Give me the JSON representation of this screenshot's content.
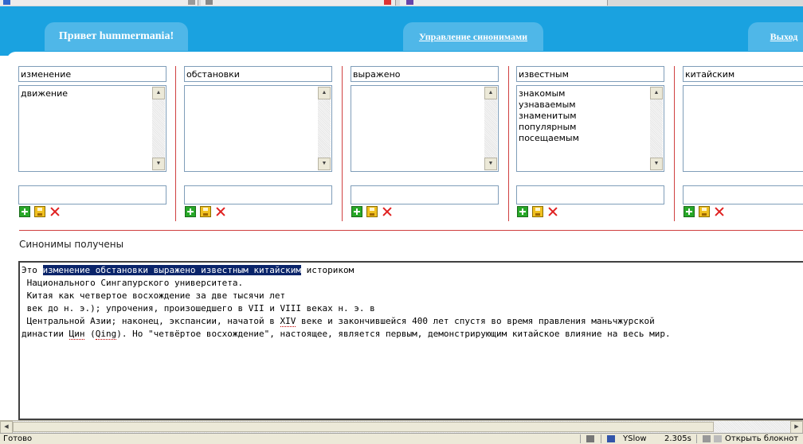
{
  "header": {
    "greeting": "Привет hummermania!",
    "manage_link": "Управление синонимами",
    "logout_link": "Выход"
  },
  "columns": [
    {
      "word": "изменение",
      "synonyms": "движение"
    },
    {
      "word": "обстановки",
      "synonyms": ""
    },
    {
      "word": "выражено",
      "synonyms": ""
    },
    {
      "word": "известным",
      "synonyms": "знакомым\nузнаваемым\nзнаменитым\nпопулярным\nпосещаемым"
    },
    {
      "word": "китайским",
      "synonyms": ""
    }
  ],
  "status_message": "Синонимы получены",
  "text": {
    "before_highlight": "Это ",
    "highlight": "изменение обстановки выражено известным китайским",
    "line1_rest": " историком",
    "line2": " Национального Сингапурского университета.",
    "line3": " Китая как четвертое восхождение за две тысячи лет",
    "line4": " век до н. э.); упрочения, произошедшего в VII и VIII веках н. э. в",
    "line5_a": " Центральной Азии; наконец, экспансии, начатой в ",
    "line5_b": "XIV",
    "line5_c": " веке и закончившейся 400 лет спустя во время правления маньчжурской",
    "line6_a": "династии ",
    "line6_b": "Цин",
    "line6_c": " (",
    "line6_d": "Qing",
    "line6_e": "). Но \"четвёртое восхождение\", настоящее, является первым, демонстрирующим китайское влияние на весь мир."
  },
  "statusbar": {
    "ready": "Готово",
    "yslow": "YSlow",
    "time": "2.305s",
    "open_notepad": "Открыть блокнот"
  }
}
